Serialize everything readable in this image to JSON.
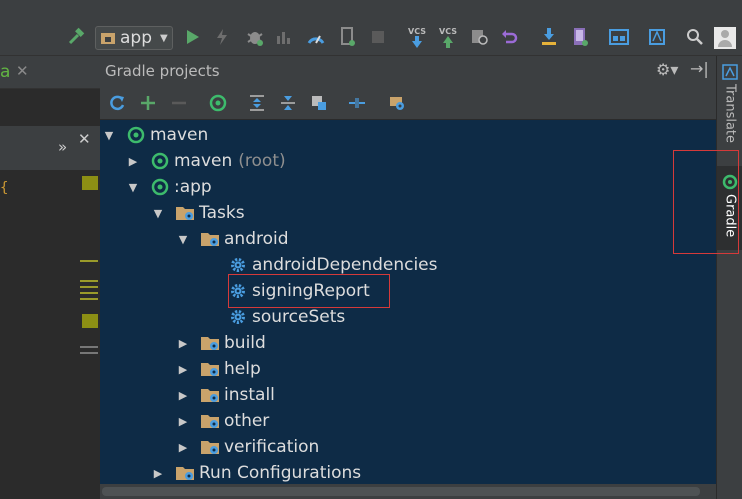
{
  "toolbar": {
    "run_config": "app",
    "vcs_update_label": "VCS",
    "vcs_commit_label": "VCS"
  },
  "editor": {
    "tab_fragment": "a",
    "overflow_glyph": "»",
    "close_glyph": "✕",
    "brace": "{"
  },
  "panel": {
    "title": "Gradle projects"
  },
  "tree": {
    "root": "maven",
    "maven_root": {
      "label": "maven",
      "suffix": "(root)"
    },
    "app": ":app",
    "tasks": "Tasks",
    "android": "android",
    "android_tasks": [
      "androidDependencies",
      "signingReport",
      "sourceSets"
    ],
    "task_groups": [
      "build",
      "help",
      "install",
      "other",
      "verification"
    ],
    "run_configurations": "Run Configurations"
  },
  "side_tabs": {
    "translate": "Translate",
    "gradle": "Gradle"
  },
  "colors": {
    "panel_bg": "#0e2b46",
    "chrome_bg": "#3c3f41",
    "gradle_green": "#3dbb6c",
    "highlight_red": "#d53a3a",
    "gear_blue": "#4a9de0",
    "folder_tan": "#c9a36b"
  }
}
